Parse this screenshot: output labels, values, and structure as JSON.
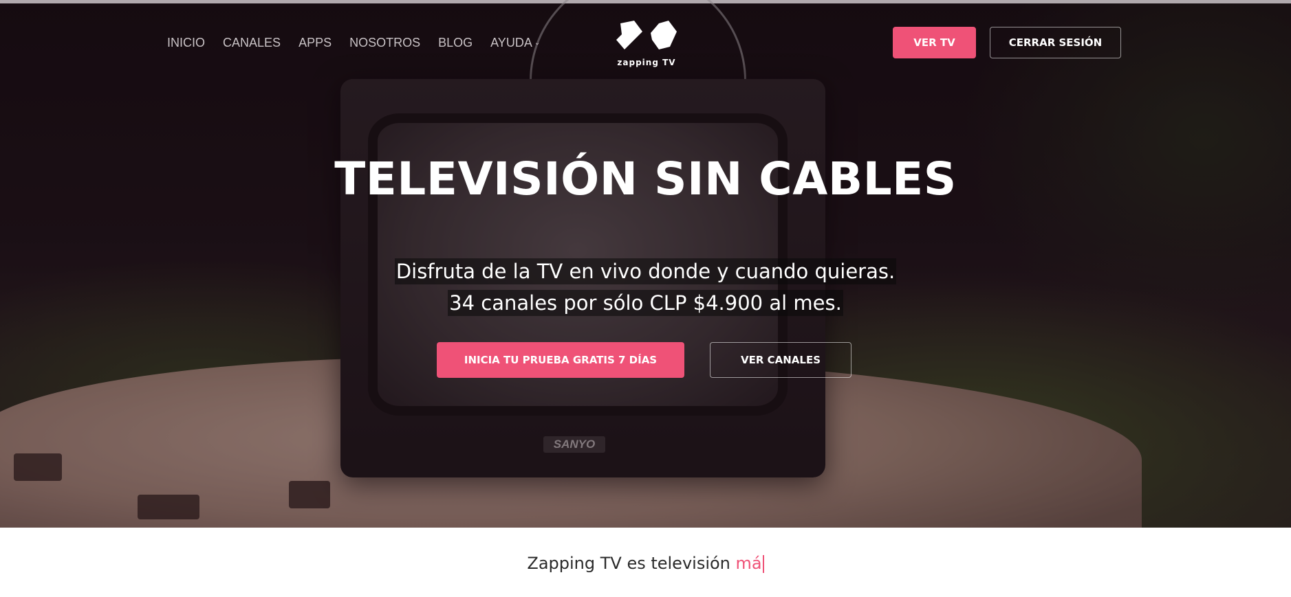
{
  "nav": {
    "items": [
      {
        "label": "INICIO"
      },
      {
        "label": "CANALES"
      },
      {
        "label": "APPS"
      },
      {
        "label": "NOSOTROS"
      },
      {
        "label": "BLOG"
      },
      {
        "label": "AYUDA",
        "has_dropdown": true
      }
    ]
  },
  "logo": {
    "text": "zapping TV"
  },
  "header_buttons": {
    "watch_tv": "VER TV",
    "logout": "CERRAR SESIÓN"
  },
  "hero": {
    "title": "TELEVISIÓN SIN CABLES",
    "subtitle_line1": "Disfruta de la TV en vivo donde y cuando quieras.",
    "subtitle_line2": "34 canales por sólo CLP $4.900 al mes.",
    "cta_trial": "INICIA TU PRUEBA GRATIS 7 DÍAS",
    "cta_channels": "VER CANALES",
    "tv_brand": "SANYO"
  },
  "tagline": {
    "prefix": "Zapping TV es televisión ",
    "typed": "má"
  },
  "colors": {
    "accent": "#ef5277",
    "hero_text": "#ffffff"
  }
}
